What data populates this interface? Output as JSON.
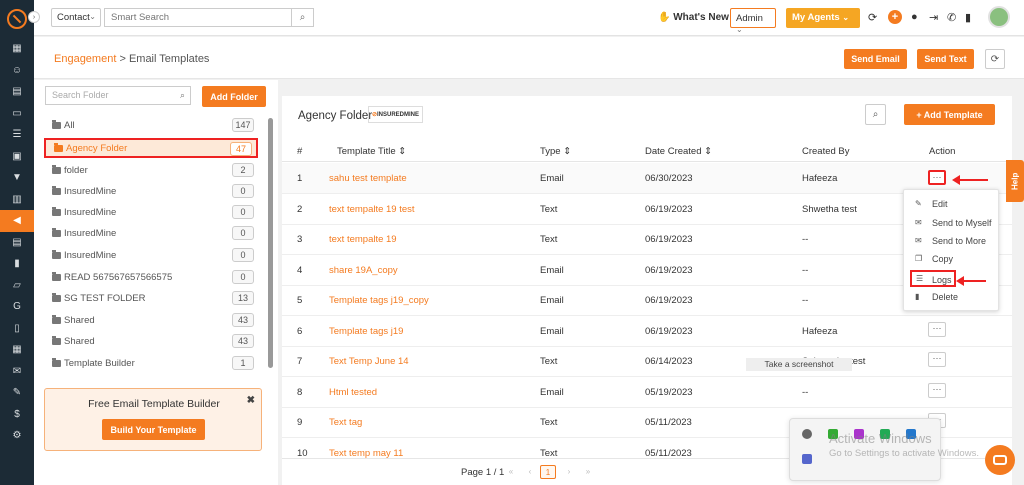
{
  "topbar": {
    "contact_select": "Contact",
    "search_placeholder": "Smart Search",
    "whats_new": "What's New",
    "role_select": "Admin",
    "agents_button": "My Agents"
  },
  "subheader": {
    "breadcrumb_root": "Engagement",
    "breadcrumb_sep": " > ",
    "breadcrumb_current": "Email Templates",
    "send_email": "Send Email",
    "send_text": "Send Text"
  },
  "folders": {
    "search_placeholder": "Search Folder",
    "add_button": "Add Folder",
    "items": [
      {
        "name": "All",
        "count": "147"
      },
      {
        "name": "Agency Folder",
        "count": "47"
      },
      {
        "name": "folder",
        "count": "2"
      },
      {
        "name": "InsuredMine",
        "count": "0"
      },
      {
        "name": "InsuredMine",
        "count": "0"
      },
      {
        "name": "InsuredMine",
        "count": "0"
      },
      {
        "name": "InsuredMine",
        "count": "0"
      },
      {
        "name": "READ 567567657566575",
        "count": "0"
      },
      {
        "name": "SG TEST FOLDER",
        "count": "13"
      },
      {
        "name": "Shared",
        "count": "43"
      },
      {
        "name": "Shared",
        "count": "43"
      },
      {
        "name": "Template Builder",
        "count": "1"
      }
    ],
    "builder_title": "Free Email Template Builder",
    "builder_button": "Build Your Template"
  },
  "main": {
    "title": "Agency Folder",
    "powered_by": "INSUREDMINE",
    "add_template": "+ Add Template",
    "columns": {
      "num": "#",
      "title": "Template Title",
      "type": "Type",
      "date": "Date Created",
      "created_by": "Created By",
      "action": "Action"
    },
    "rows": [
      {
        "num": "1",
        "title": "sahu test template",
        "type": "Email",
        "date": "06/30/2023",
        "by": "Hafeeza"
      },
      {
        "num": "2",
        "title": "text tempalte 19 test",
        "type": "Text",
        "date": "06/19/2023",
        "by": "Shwetha test"
      },
      {
        "num": "3",
        "title": "text tempalte 19",
        "type": "Text",
        "date": "06/19/2023",
        "by": "--"
      },
      {
        "num": "4",
        "title": "share 19A_copy",
        "type": "Email",
        "date": "06/19/2023",
        "by": "--"
      },
      {
        "num": "5",
        "title": "Template tags j19_copy",
        "type": "Email",
        "date": "06/19/2023",
        "by": "--"
      },
      {
        "num": "6",
        "title": "Template tags j19",
        "type": "Email",
        "date": "06/19/2023",
        "by": "Hafeeza"
      },
      {
        "num": "7",
        "title": "Text Temp June 14",
        "type": "Text",
        "date": "06/14/2023",
        "by": "Sahu sahu test"
      },
      {
        "num": "8",
        "title": "Html tested",
        "type": "Email",
        "date": "05/19/2023",
        "by": "--"
      },
      {
        "num": "9",
        "title": "Text tag",
        "type": "Text",
        "date": "05/11/2023",
        "by": ""
      },
      {
        "num": "10",
        "title": "Text temp may 11",
        "type": "Text",
        "date": "05/11/2023",
        "by": ""
      }
    ],
    "action_menu": [
      "Edit",
      "Send to Myself",
      "Send to More",
      "Copy",
      "Logs",
      "Delete"
    ]
  },
  "pager": {
    "label": "Page 1 / 1",
    "current": "1"
  },
  "overlay": {
    "tooltip": "Take a screenshot",
    "watermark_title": "Activate Windows",
    "watermark_sub": "Go to Settings to activate Windows."
  },
  "help_tab": "Help"
}
